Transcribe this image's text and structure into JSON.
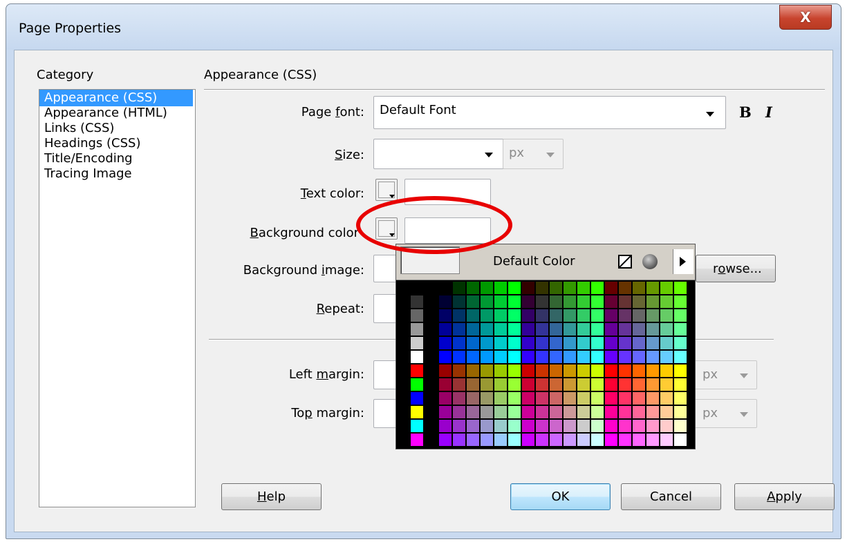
{
  "window": {
    "title": "Page Properties",
    "close_glyph": "X"
  },
  "sidebar": {
    "header": "Category",
    "items": [
      {
        "label": "Appearance (CSS)",
        "selected": true
      },
      {
        "label": "Appearance (HTML)",
        "selected": false
      },
      {
        "label": "Links (CSS)",
        "selected": false
      },
      {
        "label": "Headings (CSS)",
        "selected": false
      },
      {
        "label": "Title/Encoding",
        "selected": false
      },
      {
        "label": "Tracing Image",
        "selected": false
      }
    ]
  },
  "section": {
    "title": "Appearance (CSS)"
  },
  "page_font": {
    "label_pre": "Page ",
    "label_u": "f",
    "label_post": "ont:",
    "value": "Default Font",
    "bold_glyph": "B",
    "italic_glyph": "I"
  },
  "size": {
    "label_u": "S",
    "label_post": "ize:",
    "value": "",
    "unit": "px"
  },
  "text_color": {
    "label_u": "T",
    "label_post": "ext color:",
    "value": ""
  },
  "background_color": {
    "label_u": "B",
    "label_post": "ackground color",
    "value": ""
  },
  "background_image": {
    "label_pre": "Background ",
    "label_u": "i",
    "label_post": "mage:",
    "value": "",
    "browse_partial_pre": "r",
    "browse_partial_u": "o",
    "browse_partial_post": "wse..."
  },
  "repeat": {
    "label_u": "R",
    "label_post": "epeat:",
    "value": ""
  },
  "left_margin": {
    "label_pre": "Left ",
    "label_u": "m",
    "label_post": "argin:",
    "value": "",
    "unit": "px"
  },
  "top_margin": {
    "label_pre": "To",
    "label_u": "p",
    "label_post": " margin:",
    "value": "",
    "unit": "px"
  },
  "color_picker": {
    "default_label": "Default Color",
    "icons": [
      "no-color-icon",
      "system-color-picker-icon",
      "palette-menu-icon"
    ],
    "left_column_colors": [
      "#000000",
      "#333333",
      "#666666",
      "#999999",
      "#cccccc",
      "#ffffff",
      "#ff0000",
      "#00ff00",
      "#0000ff",
      "#ffff00",
      "#00ffff",
      "#ff00ff"
    ],
    "cube_values": [
      "00",
      "33",
      "66",
      "99",
      "cc",
      "ff"
    ]
  },
  "buttons": {
    "help_u": "H",
    "help_post": "elp",
    "ok": "OK",
    "cancel": "Cancel",
    "apply_u": "A",
    "apply_post": "pply"
  },
  "annotation": {
    "color": "#e80000"
  }
}
